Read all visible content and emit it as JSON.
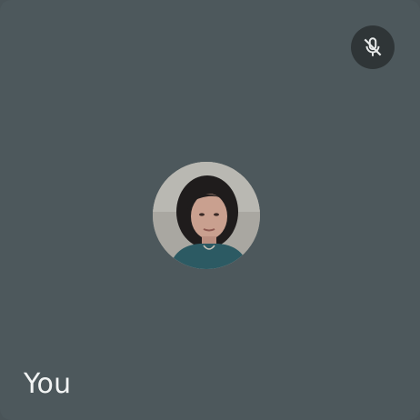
{
  "participant": {
    "display_name": "You",
    "microphone_state": "muted",
    "status_icon": "mic-off-icon",
    "avatar_icon": "profile-photo"
  },
  "colors": {
    "tile_background": "#4d585c",
    "indicator_background": "#2f3537",
    "text": "#f2f4f4"
  }
}
